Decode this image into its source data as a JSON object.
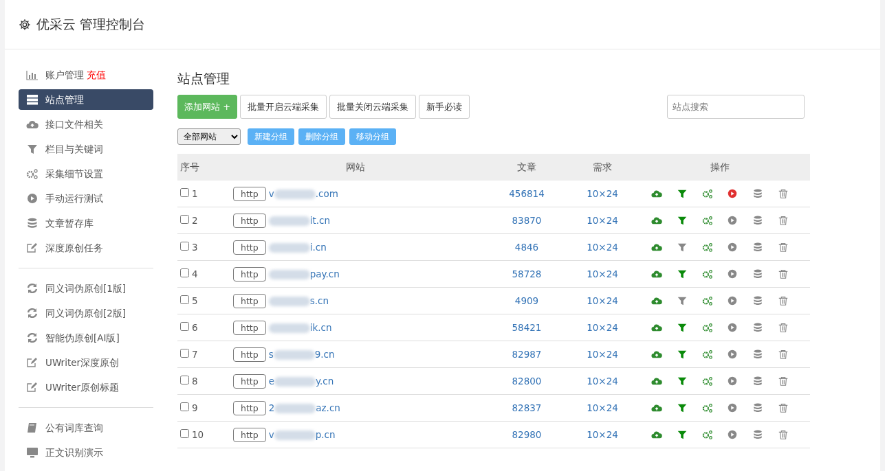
{
  "header": {
    "title": "优采云 管理控制台"
  },
  "sidebar": {
    "groups": [
      [
        {
          "label": "账户管理",
          "extra": "充值",
          "kind": "chart",
          "selected": false
        },
        {
          "label": "站点管理",
          "kind": "server",
          "selected": true
        },
        {
          "label": "接口文件相关",
          "kind": "cloud",
          "selected": false
        },
        {
          "label": "栏目与关键词",
          "kind": "filter",
          "selected": false
        },
        {
          "label": "采集细节设置",
          "kind": "gears",
          "selected": false
        },
        {
          "label": "手动运行测试",
          "kind": "play",
          "selected": false
        },
        {
          "label": "文章暂存库",
          "kind": "db",
          "selected": false
        },
        {
          "label": "深度原创任务",
          "kind": "edit",
          "selected": false
        }
      ],
      [
        {
          "label": "同义词伪原创[1版]",
          "kind": "refresh",
          "selected": false
        },
        {
          "label": "同义词伪原创[2版]",
          "kind": "refresh",
          "selected": false
        },
        {
          "label": "智能伪原创[AI版]",
          "kind": "refresh",
          "selected": false
        },
        {
          "label": "UWriter深度原创",
          "kind": "edit",
          "selected": false
        },
        {
          "label": "UWriter原创标题",
          "kind": "edit",
          "selected": false
        }
      ],
      [
        {
          "label": "公有词库查询",
          "kind": "book",
          "selected": false
        },
        {
          "label": "正文识别演示",
          "kind": "monitor",
          "selected": false
        }
      ]
    ]
  },
  "main": {
    "title": "站点管理",
    "add_button": "添加网站 +",
    "buttons": [
      "批量开启云端采集",
      "批量关闭云端采集",
      "新手必读"
    ],
    "search": {
      "placeholder": "站点搜索"
    },
    "group_select": "全部网站",
    "group_buttons": [
      "新建分组",
      "删除分组",
      "移动分组"
    ],
    "table": {
      "columns": [
        "序号",
        "网站",
        "文章",
        "需求",
        "操作"
      ],
      "rows": [
        {
          "no": "1",
          "checked": false,
          "protocol": "http",
          "site_start": "v",
          "site_end": ".com",
          "articles": "456814",
          "demand": "10×24",
          "filter_on": true,
          "running": true
        },
        {
          "no": "2",
          "checked": false,
          "protocol": "http",
          "site_start": "",
          "site_end": "it.cn",
          "articles": "83870",
          "demand": "10×24",
          "filter_on": true,
          "running": false
        },
        {
          "no": "3",
          "checked": false,
          "protocol": "http",
          "site_start": "",
          "site_end": "i.cn",
          "articles": "4846",
          "demand": "10×24",
          "filter_on": false,
          "running": false
        },
        {
          "no": "4",
          "checked": false,
          "protocol": "http",
          "site_start": "",
          "site_end": "pay.cn",
          "articles": "58728",
          "demand": "10×24",
          "filter_on": true,
          "running": false
        },
        {
          "no": "5",
          "checked": false,
          "protocol": "http",
          "site_start": "",
          "site_end": "s.cn",
          "articles": "4909",
          "demand": "10×24",
          "filter_on": false,
          "running": false
        },
        {
          "no": "6",
          "checked": false,
          "protocol": "http",
          "site_start": "",
          "site_end": "ik.cn",
          "articles": "58421",
          "demand": "10×24",
          "filter_on": true,
          "running": false
        },
        {
          "no": "7",
          "checked": false,
          "protocol": "http",
          "site_start": "s",
          "site_end": "9.cn",
          "articles": "82987",
          "demand": "10×24",
          "filter_on": true,
          "running": false
        },
        {
          "no": "8",
          "checked": false,
          "protocol": "http",
          "site_start": "e",
          "site_end": "y.cn",
          "articles": "82800",
          "demand": "10×24",
          "filter_on": true,
          "running": false
        },
        {
          "no": "9",
          "checked": false,
          "protocol": "http",
          "site_start": "2",
          "site_end": "az.cn",
          "articles": "82837",
          "demand": "10×24",
          "filter_on": true,
          "running": false
        },
        {
          "no": "10",
          "checked": false,
          "protocol": "http",
          "site_start": "v",
          "site_end": "p.cn",
          "articles": "82980",
          "demand": "10×24",
          "filter_on": true,
          "running": false
        }
      ]
    }
  }
}
